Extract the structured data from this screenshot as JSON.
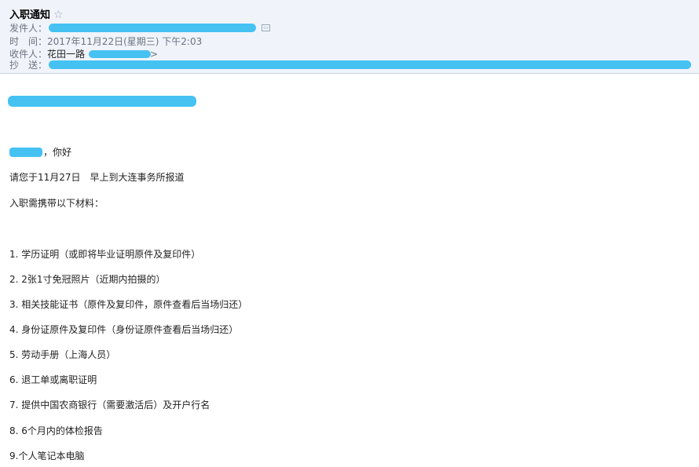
{
  "email": {
    "subject": "入职通知",
    "star_icon": "☆",
    "from_label": "发件人：",
    "time_label": "时　间：",
    "time_value": "2017年11月22日(星期三) 下午2:03",
    "to_label": "收件人：",
    "to_name": "花田一路",
    "to_open": "<",
    "to_close": ">",
    "cc_label": "抄　送："
  },
  "body": {
    "greeting": "，你好",
    "line1": "请您于11月27日　早上到大连事务所报道",
    "line2": "入职需携带以下材料：",
    "items": [
      "1. 学历证明（或即将毕业证明原件及复印件）",
      "2. 2张1寸免冠照片（近期内拍摄的）",
      "3. 相关技能证书（原件及复印件，原件查看后当场归还）",
      "4. 身份证原件及复印件（身份证原件查看后当场归还）",
      "5. 劳动手册（上海人员）",
      "6. 退工单或离职证明",
      "7. 提供中国农商银行（需要激活后）及开户行名",
      "8. 6个月内的体检报告",
      "9.个人笔记本电脑"
    ]
  }
}
